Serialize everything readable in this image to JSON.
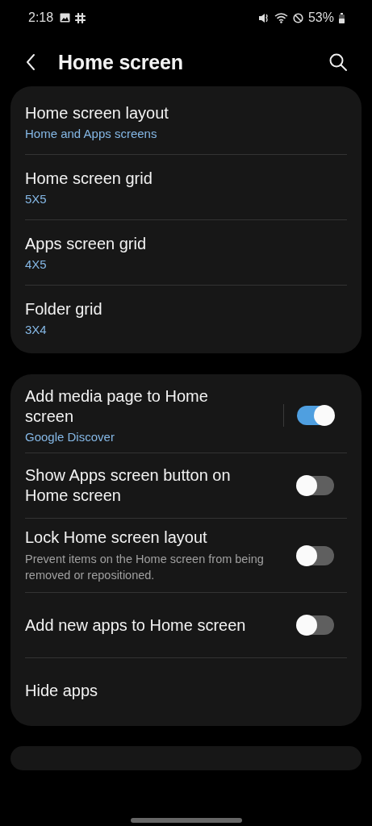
{
  "status_bar": {
    "time": "2:18",
    "battery": "53%"
  },
  "header": {
    "title": "Home screen"
  },
  "groups": [
    {
      "items": [
        {
          "kind": "link",
          "title": "Home screen layout",
          "value": "Home and Apps screens"
        },
        {
          "kind": "link",
          "title": "Home screen grid",
          "value": "5X5"
        },
        {
          "kind": "link",
          "title": "Apps screen grid",
          "value": "4X5"
        },
        {
          "kind": "link",
          "title": "Folder grid",
          "value": "3X4"
        }
      ]
    },
    {
      "items": [
        {
          "kind": "split_switch",
          "title": "Add media page to Home screen",
          "value": "Google Discover",
          "on": true
        },
        {
          "kind": "switch",
          "title": "Show Apps screen button on Home screen",
          "on": false
        },
        {
          "kind": "switch",
          "title": "Lock Home screen layout",
          "description": "Prevent items on the Home screen from being removed or repositioned.",
          "on": false
        },
        {
          "kind": "switch",
          "title": "Add new apps to Home screen",
          "on": false
        },
        {
          "kind": "link",
          "title": "Hide apps"
        }
      ]
    }
  ]
}
